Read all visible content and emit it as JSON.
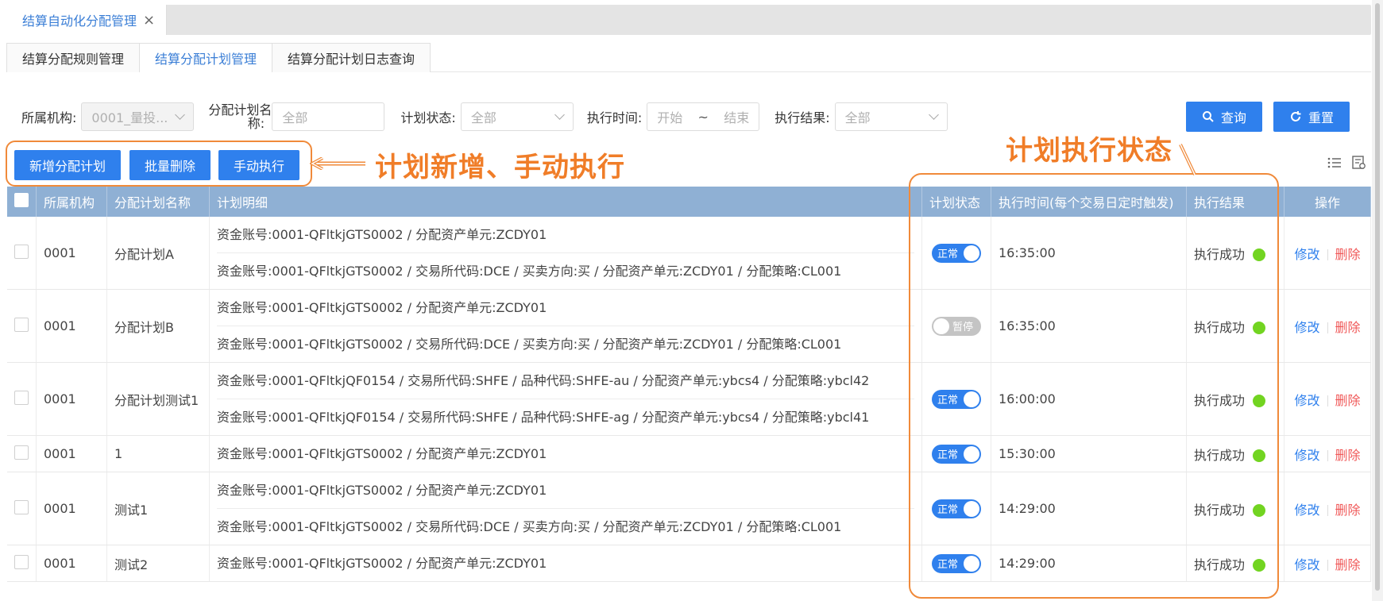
{
  "tab_bar": {
    "active_tab": "结算自动化分配管理",
    "close_symbol": "×"
  },
  "sub_tabs": [
    "结算分配规则管理",
    "结算分配计划管理",
    "结算分配计划日志查询"
  ],
  "filters": {
    "org_label": "所属机构:",
    "org_value": "0001_量投...",
    "plan_name_label_line1": "分配计划名",
    "plan_name_label_line2": "称:",
    "plan_name_placeholder": "全部",
    "status_label": "计划状态:",
    "status_placeholder": "全部",
    "time_label": "执行时间:",
    "time_start": "开始",
    "time_sep": "~",
    "time_end": "结束",
    "result_label": "执行结果:",
    "result_placeholder": "全部",
    "search_label": "查询",
    "reset_label": "重置"
  },
  "toolbar": {
    "add_label": "新增分配计划",
    "batch_delete_label": "批量删除",
    "manual_run_label": "手动执行"
  },
  "annotations": {
    "left": "计划新增、手动执行",
    "right": "计划执行状态"
  },
  "table": {
    "headers": [
      "所属机构",
      "分配计划名称",
      "计划明细",
      "计划状态",
      "执行时间(每个交易日定时触发)",
      "执行结果",
      "操作"
    ],
    "edit_label": "修改",
    "delete_label": "删除",
    "rows": [
      {
        "org": "0001",
        "name": "分配计划A",
        "details": [
          "资金账号:0001-QFltkjGTS0002 / 分配资产单元:ZCDY01",
          "资金账号:0001-QFltkjGTS0002 / 交易所代码:DCE / 买卖方向:买 / 分配资产单元:ZCDY01 / 分配策略:CL001"
        ],
        "status": "正常",
        "status_on": true,
        "time": "16:35:00",
        "result": "执行成功"
      },
      {
        "org": "0001",
        "name": "分配计划B",
        "details": [
          "资金账号:0001-QFltkjGTS0002 / 分配资产单元:ZCDY01",
          "资金账号:0001-QFltkjGTS0002 / 交易所代码:DCE / 买卖方向:买 / 分配资产单元:ZCDY01 / 分配策略:CL001"
        ],
        "status": "暂停",
        "status_on": false,
        "time": "16:35:00",
        "result": "执行成功"
      },
      {
        "org": "0001",
        "name": "分配计划测试1",
        "details": [
          "资金账号:0001-QFltkjQF0154 / 交易所代码:SHFE / 品种代码:SHFE-au / 分配资产单元:ybcs4 / 分配策略:ybcl42",
          "资金账号:0001-QFltkjQF0154 / 交易所代码:SHFE / 品种代码:SHFE-ag / 分配资产单元:ybcs4 / 分配策略:ybcl41"
        ],
        "status": "正常",
        "status_on": true,
        "time": "16:00:00",
        "result": "执行成功"
      },
      {
        "org": "0001",
        "name": "1",
        "details": [
          "资金账号:0001-QFltkjGTS0002 / 分配资产单元:ZCDY01"
        ],
        "status": "正常",
        "status_on": true,
        "time": "15:30:00",
        "result": "执行成功"
      },
      {
        "org": "0001",
        "name": "测试1",
        "details": [
          "资金账号:0001-QFltkjGTS0002 / 分配资产单元:ZCDY01",
          "资金账号:0001-QFltkjGTS0002 / 交易所代码:DCE / 买卖方向:买 / 分配资产单元:ZCDY01 / 分配策略:CL001"
        ],
        "status": "正常",
        "status_on": true,
        "time": "14:29:00",
        "result": "执行成功"
      },
      {
        "org": "0001",
        "name": "测试2",
        "details": [
          "资金账号:0001-QFltkjGTS0002 / 分配资产单元:ZCDY01"
        ],
        "status": "正常",
        "status_on": true,
        "time": "14:29:00",
        "result": "执行成功"
      }
    ]
  },
  "colors": {
    "accent": "#2f80ed",
    "header_bg": "#8fb0d4",
    "annotation": "#f07d28",
    "success_dot": "#72d421",
    "delete": "#f05a5a"
  }
}
